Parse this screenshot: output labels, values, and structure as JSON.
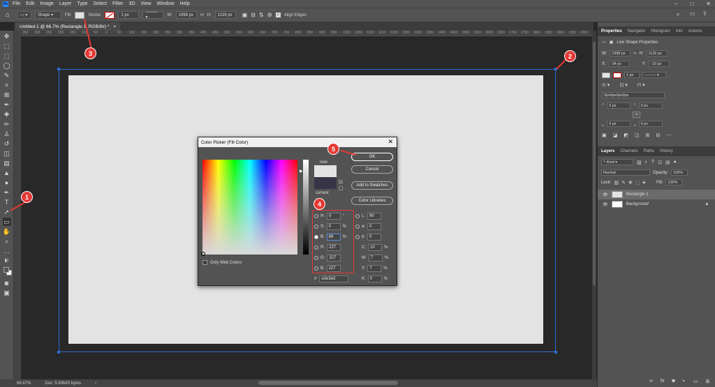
{
  "menu": [
    "File",
    "Edit",
    "Image",
    "Layer",
    "Type",
    "Select",
    "Filter",
    "3D",
    "View",
    "Window",
    "Help"
  ],
  "options": {
    "mode": "Shape",
    "fill_label": "Fill:",
    "stroke_label": "Stroke:",
    "stroke_size": "1 px",
    "w_label": "W:",
    "w_value": "1998 px",
    "h_label": "H:",
    "h_value": "1139 px",
    "align_edges": "Align Edges"
  },
  "document_tab": "Untitled-1 @ 66.7% (Rectangle 1, RGB/8#) *",
  "ruler_ticks": [
    "350",
    "300",
    "250",
    "200",
    "150",
    "100",
    "50",
    "0",
    "50",
    "100",
    "150",
    "200",
    "250",
    "300",
    "350",
    "400",
    "450",
    "500",
    "550",
    "600",
    "650",
    "700",
    "750",
    "800",
    "850",
    "900",
    "950",
    "1000",
    "1050",
    "1100",
    "1150",
    "1200",
    "1250",
    "1300",
    "1350",
    "1400",
    "1450",
    "1500",
    "1550",
    "1600",
    "1650",
    "1700",
    "1750",
    "1800",
    "1850",
    "1900",
    "1950",
    "2000",
    "2050"
  ],
  "status": {
    "zoom": "66.67%",
    "doc": "Doc: 5.93M/0 bytes"
  },
  "properties": {
    "tabs": [
      "Properties",
      "Navigator",
      "Histogram",
      "Info",
      "Actions"
    ],
    "subtitle": "Live Shape Properties",
    "w_label": "W:",
    "w": "1998 px",
    "h_label": "H:",
    "h": "1139 px",
    "x_label": "X:",
    "x": "-34 px",
    "y_label": "Y:",
    "y": "-23 px",
    "stroke": "1 px",
    "corners": "0px0px0px0px",
    "c1": "0 px",
    "c2": "0 px",
    "c3": "0 px",
    "c4": "0 px"
  },
  "layers": {
    "tabs": [
      "Layers",
      "Channels",
      "Paths",
      "History"
    ],
    "kind": "Kind",
    "blend": "Normal",
    "opacity_label": "Opacity:",
    "opacity": "100%",
    "lock_label": "Lock:",
    "fill_label": "Fill:",
    "fill": "100%",
    "items": [
      {
        "name": "Rectangle 1"
      },
      {
        "name": "Background"
      }
    ]
  },
  "dialog": {
    "title": "Color Picker (Fill Color)",
    "new_label": "new",
    "current_label": "current",
    "ok": "OK",
    "cancel": "Cancel",
    "add_swatches": "Add to Swatches",
    "color_libraries": "Color Libraries",
    "only_web": "Only Web Colors",
    "h": {
      "label": "H:",
      "value": "0",
      "unit": "°"
    },
    "s": {
      "label": "S:",
      "value": "0",
      "unit": "%"
    },
    "b": {
      "label": "B:",
      "value": "89",
      "unit": "%"
    },
    "r": {
      "label": "R:",
      "value": "227"
    },
    "g": {
      "label": "G:",
      "value": "227"
    },
    "bl": {
      "label": "B:",
      "value": "227"
    },
    "L": {
      "label": "L:",
      "value": "90"
    },
    "a": {
      "label": "a:",
      "value": "0"
    },
    "lb": {
      "label": "b:",
      "value": "0"
    },
    "C": {
      "label": "C:",
      "value": "10",
      "unit": "%"
    },
    "M": {
      "label": "M:",
      "value": "7",
      "unit": "%"
    },
    "Y": {
      "label": "Y:",
      "value": "7",
      "unit": "%"
    },
    "K": {
      "label": "K:",
      "value": "0",
      "unit": "%"
    },
    "hex_label": "#",
    "hex": "e3e3e3"
  },
  "badges": [
    "1",
    "2",
    "3",
    "4",
    "5"
  ],
  "colors": {
    "fill": "#e3e3e3",
    "current": "#373448",
    "accent": "#2c6bd4",
    "badge": "#e53935"
  }
}
